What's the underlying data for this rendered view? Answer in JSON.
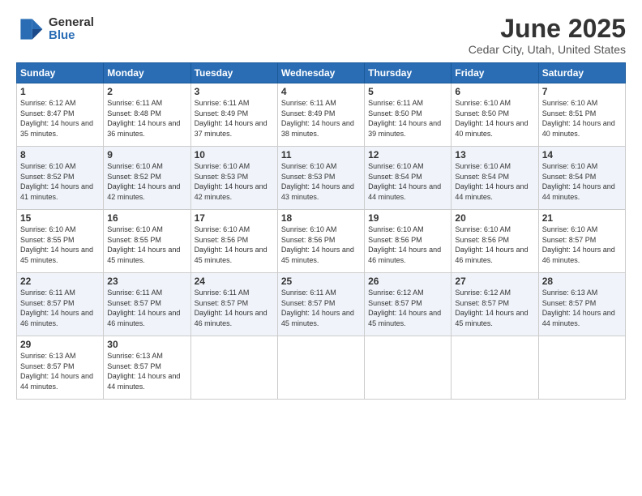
{
  "logo": {
    "general": "General",
    "blue": "Blue"
  },
  "title": "June 2025",
  "subtitle": "Cedar City, Utah, United States",
  "days_header": [
    "Sunday",
    "Monday",
    "Tuesday",
    "Wednesday",
    "Thursday",
    "Friday",
    "Saturday"
  ],
  "weeks": [
    [
      {
        "day": "1",
        "sunrise": "6:12 AM",
        "sunset": "8:47 PM",
        "daylight": "14 hours and 35 minutes."
      },
      {
        "day": "2",
        "sunrise": "6:11 AM",
        "sunset": "8:48 PM",
        "daylight": "14 hours and 36 minutes."
      },
      {
        "day": "3",
        "sunrise": "6:11 AM",
        "sunset": "8:49 PM",
        "daylight": "14 hours and 37 minutes."
      },
      {
        "day": "4",
        "sunrise": "6:11 AM",
        "sunset": "8:49 PM",
        "daylight": "14 hours and 38 minutes."
      },
      {
        "day": "5",
        "sunrise": "6:11 AM",
        "sunset": "8:50 PM",
        "daylight": "14 hours and 39 minutes."
      },
      {
        "day": "6",
        "sunrise": "6:10 AM",
        "sunset": "8:50 PM",
        "daylight": "14 hours and 40 minutes."
      },
      {
        "day": "7",
        "sunrise": "6:10 AM",
        "sunset": "8:51 PM",
        "daylight": "14 hours and 40 minutes."
      }
    ],
    [
      {
        "day": "8",
        "sunrise": "6:10 AM",
        "sunset": "8:52 PM",
        "daylight": "14 hours and 41 minutes."
      },
      {
        "day": "9",
        "sunrise": "6:10 AM",
        "sunset": "8:52 PM",
        "daylight": "14 hours and 42 minutes."
      },
      {
        "day": "10",
        "sunrise": "6:10 AM",
        "sunset": "8:53 PM",
        "daylight": "14 hours and 42 minutes."
      },
      {
        "day": "11",
        "sunrise": "6:10 AM",
        "sunset": "8:53 PM",
        "daylight": "14 hours and 43 minutes."
      },
      {
        "day": "12",
        "sunrise": "6:10 AM",
        "sunset": "8:54 PM",
        "daylight": "14 hours and 44 minutes."
      },
      {
        "day": "13",
        "sunrise": "6:10 AM",
        "sunset": "8:54 PM",
        "daylight": "14 hours and 44 minutes."
      },
      {
        "day": "14",
        "sunrise": "6:10 AM",
        "sunset": "8:54 PM",
        "daylight": "14 hours and 44 minutes."
      }
    ],
    [
      {
        "day": "15",
        "sunrise": "6:10 AM",
        "sunset": "8:55 PM",
        "daylight": "14 hours and 45 minutes."
      },
      {
        "day": "16",
        "sunrise": "6:10 AM",
        "sunset": "8:55 PM",
        "daylight": "14 hours and 45 minutes."
      },
      {
        "day": "17",
        "sunrise": "6:10 AM",
        "sunset": "8:56 PM",
        "daylight": "14 hours and 45 minutes."
      },
      {
        "day": "18",
        "sunrise": "6:10 AM",
        "sunset": "8:56 PM",
        "daylight": "14 hours and 45 minutes."
      },
      {
        "day": "19",
        "sunrise": "6:10 AM",
        "sunset": "8:56 PM",
        "daylight": "14 hours and 46 minutes."
      },
      {
        "day": "20",
        "sunrise": "6:10 AM",
        "sunset": "8:56 PM",
        "daylight": "14 hours and 46 minutes."
      },
      {
        "day": "21",
        "sunrise": "6:10 AM",
        "sunset": "8:57 PM",
        "daylight": "14 hours and 46 minutes."
      }
    ],
    [
      {
        "day": "22",
        "sunrise": "6:11 AM",
        "sunset": "8:57 PM",
        "daylight": "14 hours and 46 minutes."
      },
      {
        "day": "23",
        "sunrise": "6:11 AM",
        "sunset": "8:57 PM",
        "daylight": "14 hours and 46 minutes."
      },
      {
        "day": "24",
        "sunrise": "6:11 AM",
        "sunset": "8:57 PM",
        "daylight": "14 hours and 46 minutes."
      },
      {
        "day": "25",
        "sunrise": "6:11 AM",
        "sunset": "8:57 PM",
        "daylight": "14 hours and 45 minutes."
      },
      {
        "day": "26",
        "sunrise": "6:12 AM",
        "sunset": "8:57 PM",
        "daylight": "14 hours and 45 minutes."
      },
      {
        "day": "27",
        "sunrise": "6:12 AM",
        "sunset": "8:57 PM",
        "daylight": "14 hours and 45 minutes."
      },
      {
        "day": "28",
        "sunrise": "6:13 AM",
        "sunset": "8:57 PM",
        "daylight": "14 hours and 44 minutes."
      }
    ],
    [
      {
        "day": "29",
        "sunrise": "6:13 AM",
        "sunset": "8:57 PM",
        "daylight": "14 hours and 44 minutes."
      },
      {
        "day": "30",
        "sunrise": "6:13 AM",
        "sunset": "8:57 PM",
        "daylight": "14 hours and 44 minutes."
      },
      null,
      null,
      null,
      null,
      null
    ]
  ]
}
